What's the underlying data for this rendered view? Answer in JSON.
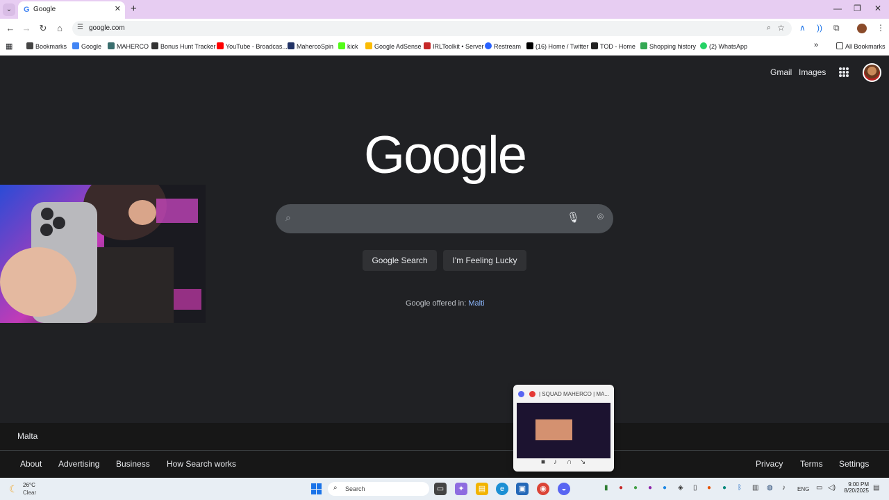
{
  "browser": {
    "tab_title": "Google",
    "url": "google.com"
  },
  "bookmarks": [
    {
      "label": "Bookmarks",
      "icon": "star-icon",
      "color": "#444444"
    },
    {
      "label": "Google",
      "icon": "google-icon",
      "color": "#4285f4"
    },
    {
      "label": "MAHERCO",
      "icon": "maherco-icon",
      "color": "#3a6e6e"
    },
    {
      "label": "Bonus Hunt Tracker",
      "icon": "bonus-icon",
      "color": "#333333"
    },
    {
      "label": "YouTube - Broadcas...",
      "icon": "youtube-icon",
      "color": "#ff0000"
    },
    {
      "label": "MahercoSpin",
      "icon": "spin-icon",
      "color": "#223366"
    },
    {
      "label": "kick",
      "icon": "kick-icon",
      "color": "#53fc18"
    },
    {
      "label": "Google AdSense",
      "icon": "adsense-icon",
      "color": "#fbbc04"
    },
    {
      "label": "IRLToolkit • Server",
      "icon": "irl-icon",
      "color": "#c62828"
    },
    {
      "label": "Restream",
      "icon": "restream-icon",
      "color": "#2962ff"
    },
    {
      "label": "(16) Home / Twitter",
      "icon": "x-icon",
      "color": "#000000"
    },
    {
      "label": "TOD - Home",
      "icon": "tod-icon",
      "color": "#222222"
    },
    {
      "label": "Shopping history",
      "icon": "shopping-icon",
      "color": "#34a853"
    },
    {
      "label": "(2) WhatsApp",
      "icon": "whatsapp-icon",
      "color": "#25d366"
    }
  ],
  "all_bookmarks": "All Bookmarks",
  "google": {
    "top_links": {
      "gmail": "Gmail",
      "images": "Images"
    },
    "logo": "Google",
    "search_button": "Google Search",
    "lucky_button": "I'm Feeling Lucky",
    "offered_prefix": "Google offered in:",
    "offered_lang": "Malti",
    "country": "Malta",
    "footer_left": [
      "About",
      "Advertising",
      "Business",
      "How Search works"
    ],
    "footer_right": [
      "Privacy",
      "Terms",
      "Settings"
    ]
  },
  "preview": {
    "title": "| SQUAD MAHERCO | MA..."
  },
  "taskbar": {
    "temperature": "26°C",
    "weather": "Clear",
    "search": "Search",
    "language": "ENG",
    "time": "9:00 PM",
    "date": "8/20/2025"
  }
}
